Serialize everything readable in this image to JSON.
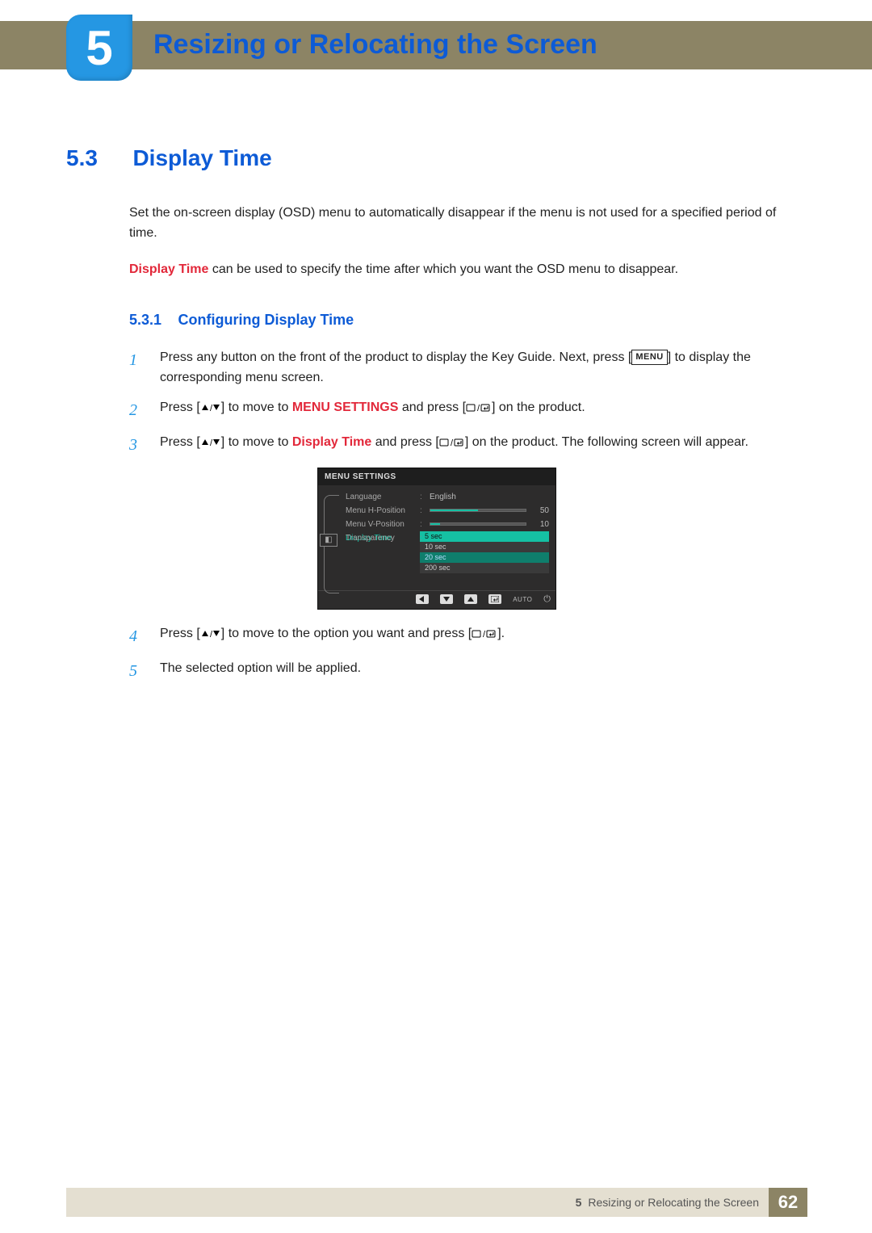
{
  "chapter": {
    "number": "5",
    "title": "Resizing or Relocating the Screen"
  },
  "section": {
    "number": "5.3",
    "title": "Display Time"
  },
  "intro": {
    "p1": "Set the on-screen display (OSD) menu to automatically disappear if the menu is not used for a specified period of time.",
    "p2_lead": "Display Time",
    "p2_rest": " can be used to specify the time after which you want the OSD menu to disappear."
  },
  "subsection": {
    "number": "5.3.1",
    "title": "Configuring Display Time"
  },
  "steps": {
    "s1": {
      "n": "1",
      "a": "Press any button on the front of the product to display the Key Guide. Next, press [",
      "menu": "MENU",
      "b": "] to display the corresponding menu screen."
    },
    "s2": {
      "n": "2",
      "a": "Press [",
      "b": "] to move to ",
      "target": "MENU SETTINGS",
      "c": " and press [",
      "d": "] on the product."
    },
    "s3": {
      "n": "3",
      "a": "Press [",
      "b": "] to move to ",
      "target": "Display Time",
      "c": " and press [",
      "d": "] on the product. The following screen will appear."
    },
    "s4": {
      "n": "4",
      "a": "Press [",
      "b": "] to move to the option you want and press [",
      "c": "]."
    },
    "s5": {
      "n": "5",
      "text": "The selected option will be applied."
    }
  },
  "osd": {
    "title": "MENU SETTINGS",
    "rows": {
      "language": {
        "label": "Language",
        "value": "English"
      },
      "hpos": {
        "label": "Menu H-Position",
        "value": "50",
        "fill": 50
      },
      "vpos": {
        "label": "Menu V-Position",
        "value": "10",
        "fill": 10
      },
      "dtime": {
        "label": "Display Time"
      },
      "trans": {
        "label": "Transparency"
      }
    },
    "options": [
      "5 sec",
      "10 sec",
      "20 sec",
      "200 sec"
    ],
    "bottom_auto": "AUTO"
  },
  "footer": {
    "chapter_num": "5",
    "chapter_title": "Resizing or Relocating the Screen",
    "page": "62"
  }
}
